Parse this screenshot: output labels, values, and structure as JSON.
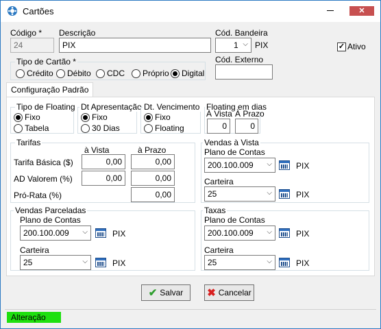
{
  "window": {
    "title": "Cartões",
    "close_glyph": "✕"
  },
  "header": {
    "codigo_label": "Código *",
    "codigo_value": "24",
    "descricao_label": "Descrição",
    "descricao_value": "PIX",
    "cod_bandeira_label": "Cód. Bandeira",
    "cod_bandeira_value": "1",
    "bandeira_name": "PIX",
    "ativo_label": "Ativo",
    "ativo_checked": true,
    "cod_externo_label": "Cód. Externo",
    "cod_externo_value": ""
  },
  "tipo_cartao": {
    "label": "Tipo de Cartão  *",
    "options": [
      "Crédito",
      "Débito",
      "CDC",
      "Próprio",
      "Digital"
    ],
    "selected": "Digital"
  },
  "tabs": [
    {
      "label": "Configuração Padrão"
    }
  ],
  "tipo_floating": {
    "label": "Tipo de Floating",
    "options": [
      "Fixo",
      "Tabela"
    ],
    "selected": "Fixo"
  },
  "dt_apresentacao": {
    "label": "Dt Apresentação",
    "options": [
      "Fixo",
      "30 Dias"
    ],
    "selected": "Fixo"
  },
  "dt_vencimento": {
    "label": "Dt. Vencimento",
    "options": [
      "Fixo",
      "Floating"
    ],
    "selected": "Fixo"
  },
  "floating_dias": {
    "label": "Floating em dias",
    "a_vista_label": "À Vista",
    "a_prazo_label": "À Prazo",
    "a_vista_value": "0",
    "a_prazo_value": "0"
  },
  "tarifas": {
    "label": "Tarifas",
    "col_a_vista": "à Vista",
    "col_a_prazo": "à Prazo",
    "rows": [
      {
        "label": "Tarifa Básica ($)",
        "a_vista": "0,00",
        "a_prazo": "0,00"
      },
      {
        "label": "AD Valorem (%)",
        "a_vista": "0,00",
        "a_prazo": "0,00"
      },
      {
        "label": "Pró-Rata (%)",
        "a_prazo": "0,00"
      }
    ]
  },
  "vendas_vista": {
    "label": "Vendas à Vista",
    "plano_label": "Plano de Contas",
    "plano_value": "200.100.009",
    "plano_name": "PIX",
    "carteira_label": "Carteira",
    "carteira_value": "25",
    "carteira_name": "PIX"
  },
  "vendas_parceladas": {
    "label": "Vendas Parceladas",
    "plano_label": "Plano de Contas",
    "plano_value": "200.100.009",
    "plano_name": "PIX",
    "carteira_label": "Carteira",
    "carteira_value": "25",
    "carteira_name": "PIX"
  },
  "taxas": {
    "label": "Taxas",
    "plano_label": "Plano de Contas",
    "plano_value": "200.100.009",
    "plano_name": "PIX",
    "carteira_label": "Carteira",
    "carteira_value": "25",
    "carteira_name": "PIX"
  },
  "buttons": {
    "salvar": "Salvar",
    "cancelar": "Cancelar"
  },
  "status": {
    "mode": "Alteração",
    "color": "#1ee00f"
  },
  "colors": {
    "window_border": "#2b79c2",
    "close_button": "#c75050",
    "save_icon": "#2e9e2e",
    "cancel_icon": "#d81f1f"
  },
  "icons": {
    "app": "film-reel-icon",
    "dropdown": "chevron-down-icon",
    "lookup": "calendar-grid-icon",
    "save": "checkmark-icon",
    "cancel": "x-icon"
  }
}
